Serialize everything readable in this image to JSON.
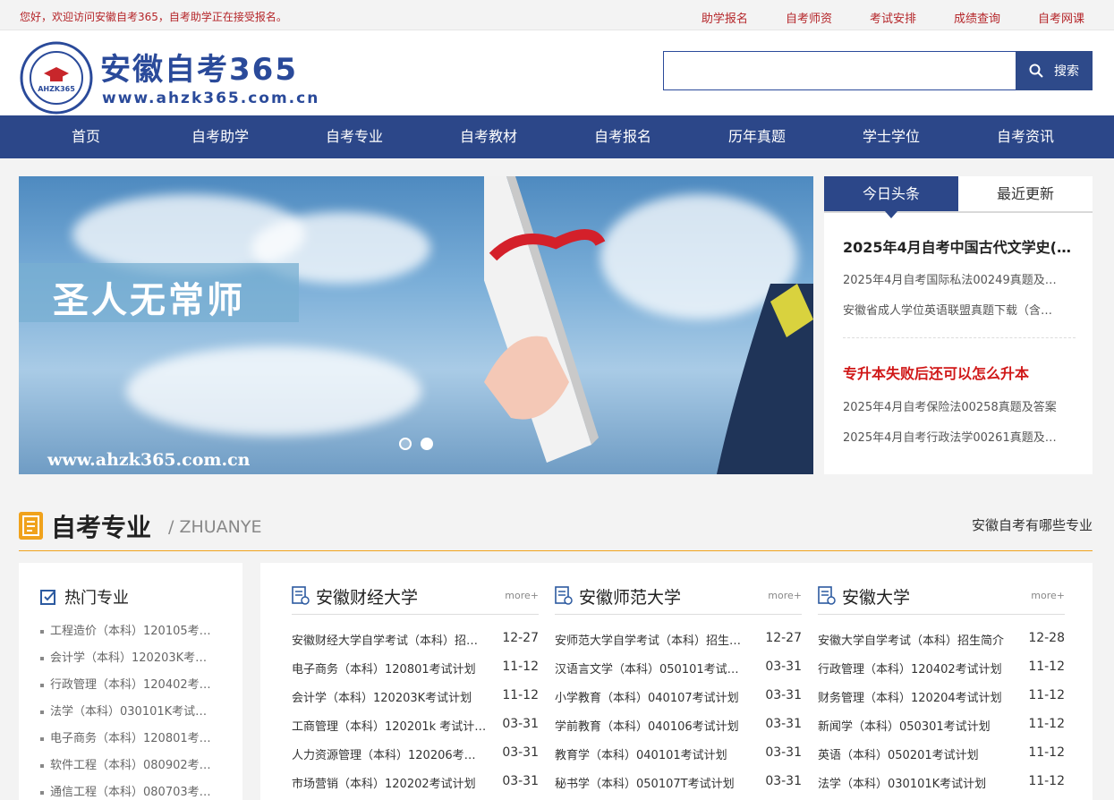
{
  "topbar": {
    "welcome": "您好，欢迎访问安徽自考365，自考助学正在接受报名。",
    "links": [
      "助学报名",
      "自考师资",
      "考试安排",
      "成绩查询",
      "自考网课"
    ]
  },
  "header": {
    "logo_title": "安徽自考365",
    "logo_url": "www.ahzk365.com.cn",
    "seal_text": "AHZK365",
    "search_placeholder": "",
    "search_label": "搜索"
  },
  "nav": [
    "首页",
    "自考助学",
    "自考专业",
    "自考教材",
    "自考报名",
    "历年真题",
    "学士学位",
    "自考资讯"
  ],
  "banner": {
    "slogan": "圣人无常师",
    "url": "www.ahzk365.com.cn"
  },
  "news": {
    "tabs": [
      "今日头条",
      "最近更新"
    ],
    "headline1": "2025年4月自考中国古代文学史(一…",
    "items1": [
      "2025年4月自考国际私法00249真题及…",
      "安徽省成人学位英语联盟真题下载（含…"
    ],
    "headline2": "专升本失败后还可以怎么升本",
    "items2": [
      "2025年4月自考保险法00258真题及答案",
      "2025年4月自考行政法学00261真题及…"
    ]
  },
  "section": {
    "title": "自考专业",
    "subtitle": "/ ZHUANYE",
    "right_link": "安徽自考有哪些专业"
  },
  "hot": {
    "title": "热门专业",
    "items": [
      "工程造价（本科）120105考…",
      "会计学（本科）120203K考…",
      "行政管理（本科）120402考…",
      "法学（本科）030101K考试…",
      "电子商务（本科）120801考…",
      "软件工程（本科）080902考…",
      "通信工程（本科）080703考…"
    ]
  },
  "universities": [
    {
      "name": "安徽财经大学",
      "more": "more+",
      "rows": [
        {
          "title": "安徽财经大学自学考试（本科）招…",
          "date": "12-27"
        },
        {
          "title": "电子商务（本科）120801考试计划",
          "date": "11-12"
        },
        {
          "title": "会计学（本科）120203K考试计划",
          "date": "11-12"
        },
        {
          "title": "工商管理（本科）120201k 考试计…",
          "date": "03-31"
        },
        {
          "title": "人力资源管理（本科）120206考…",
          "date": "03-31"
        },
        {
          "title": "市场营销（本科）120202考试计划",
          "date": "03-31"
        }
      ]
    },
    {
      "name": "安徽师范大学",
      "more": "more+",
      "rows": [
        {
          "title": "安师范大学自学考试（本科）招生…",
          "date": "12-27"
        },
        {
          "title": "汉语言文学（本科）050101考试…",
          "date": "03-31"
        },
        {
          "title": "小学教育（本科）040107考试计划",
          "date": "03-31"
        },
        {
          "title": "学前教育（本科）040106考试计划",
          "date": "03-31"
        },
        {
          "title": "教育学（本科）040101考试计划",
          "date": "03-31"
        },
        {
          "title": "秘书学（本科）050107T考试计划",
          "date": "03-31"
        }
      ]
    },
    {
      "name": "安徽大学",
      "more": "more+",
      "rows": [
        {
          "title": "安徽大学自学考试（本科）招生简介",
          "date": "12-28"
        },
        {
          "title": "行政管理（本科）120402考试计划",
          "date": "11-12"
        },
        {
          "title": "财务管理（本科）120204考试计划",
          "date": "11-12"
        },
        {
          "title": "新闻学（本科）050301考试计划",
          "date": "11-12"
        },
        {
          "title": "英语（本科）050201考试计划",
          "date": "11-12"
        },
        {
          "title": "法学（本科）030101K考试计划",
          "date": "11-12"
        }
      ]
    }
  ],
  "colors": {
    "brand_blue": "#2c4789",
    "accent_red": "#b5262a",
    "accent_orange": "#f0a21c"
  }
}
